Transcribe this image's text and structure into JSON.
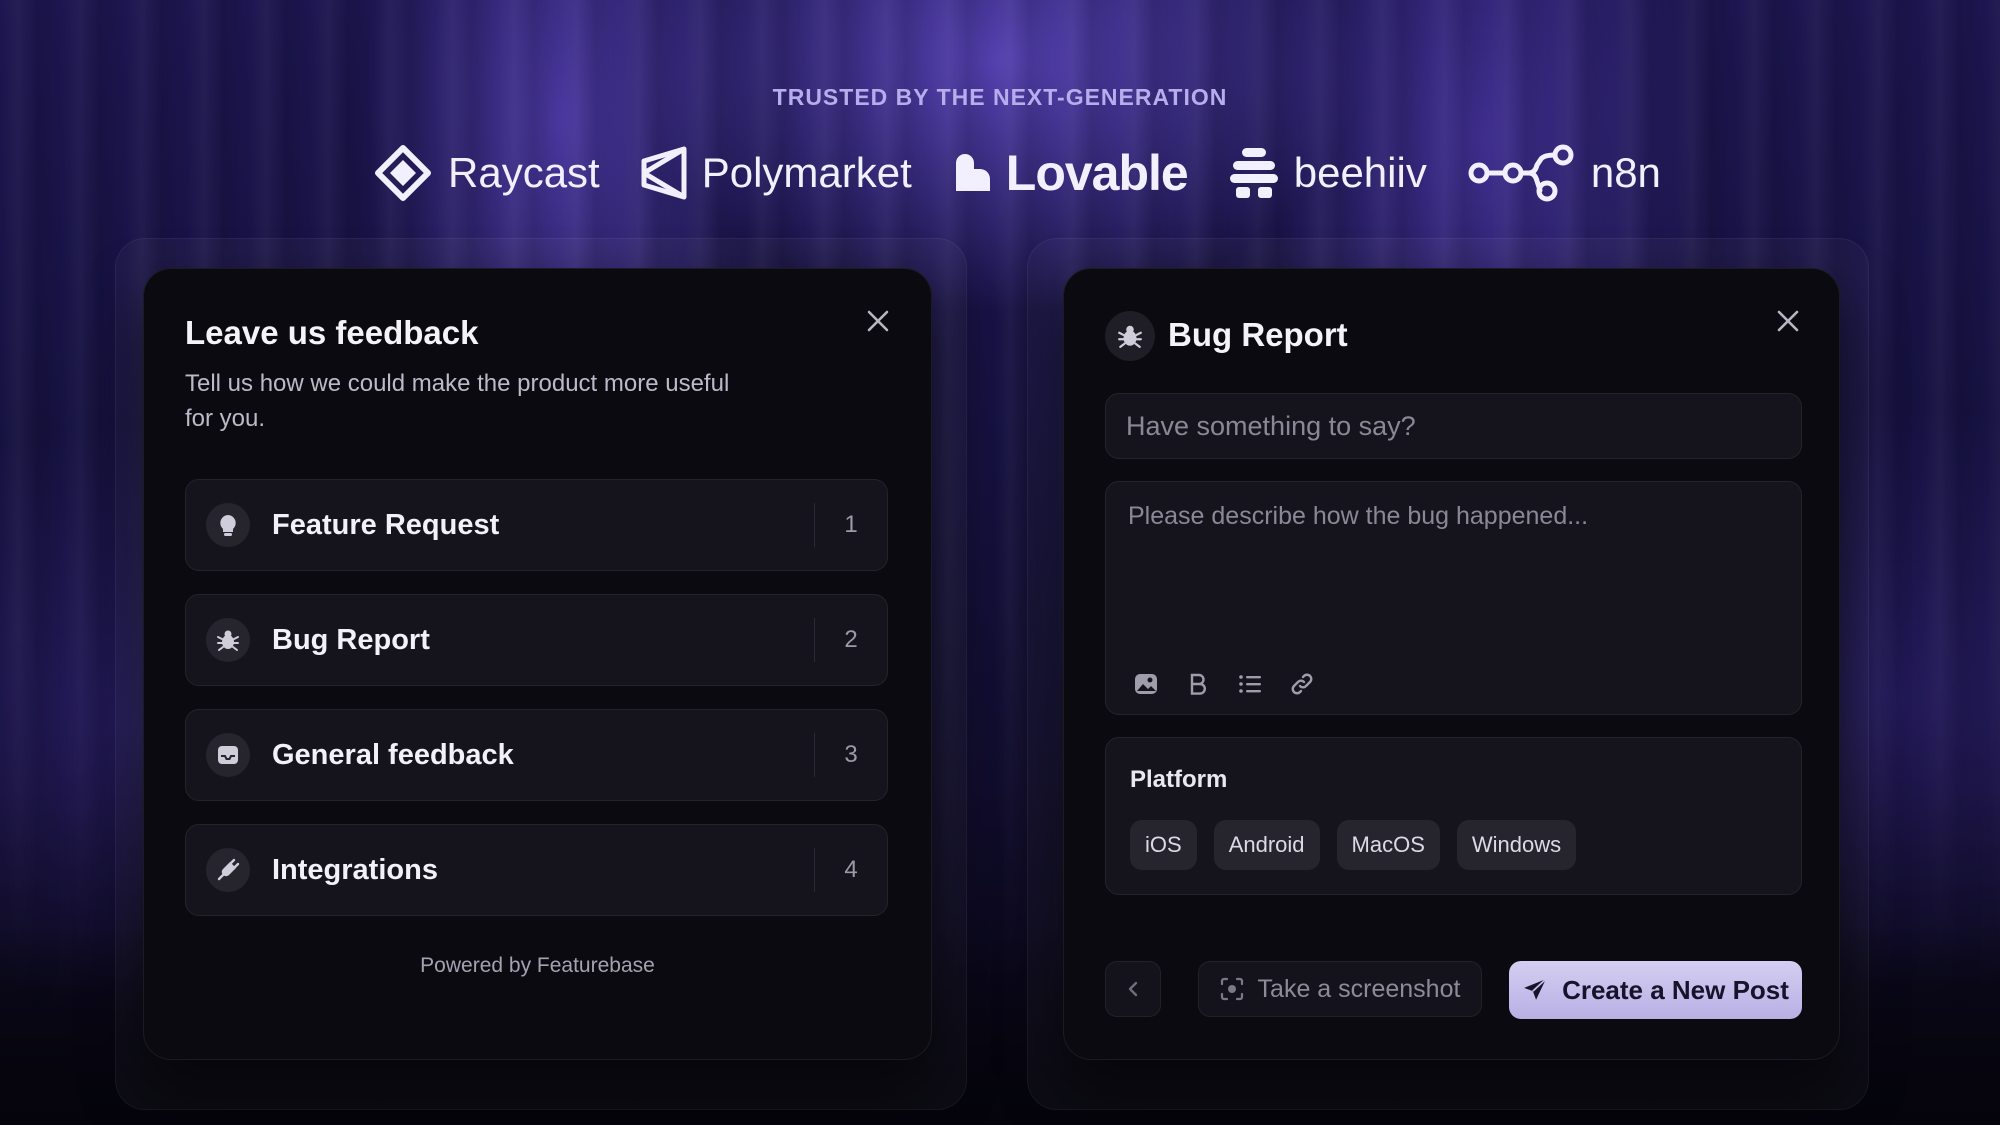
{
  "hero": {
    "trusted_label": "TRUSTED BY THE NEXT-GENERATION",
    "logos": [
      {
        "name": "Raycast",
        "icon": "raycast-logo"
      },
      {
        "name": "Polymarket",
        "icon": "polymarket-logo"
      },
      {
        "name": "Lovable",
        "icon": "lovable-logo"
      },
      {
        "name": "beehiiv",
        "icon": "beehiiv-logo"
      },
      {
        "name": "n8n",
        "icon": "n8n-logo"
      }
    ]
  },
  "feedback_panel": {
    "title": "Leave us feedback",
    "subtitle": "Tell us how we could make the product more useful for you.",
    "close_icon": "close-icon",
    "options": [
      {
        "label": "Feature Request",
        "number": "1",
        "icon": "lightbulb-icon"
      },
      {
        "label": "Bug Report",
        "number": "2",
        "icon": "bug-icon"
      },
      {
        "label": "General feedback",
        "number": "3",
        "icon": "inbox-icon"
      },
      {
        "label": "Integrations",
        "number": "4",
        "icon": "plug-icon"
      }
    ],
    "powered_by": "Powered by Featurebase"
  },
  "bug_panel": {
    "title": "Bug Report",
    "title_icon": "bug-icon",
    "close_icon": "close-icon",
    "title_input": {
      "placeholder": "Have something to say?",
      "value": ""
    },
    "description": {
      "placeholder": "Please describe how the bug happened...",
      "value": ""
    },
    "toolbar": [
      "image-icon",
      "bold-icon",
      "list-icon",
      "link-icon"
    ],
    "platform": {
      "label": "Platform",
      "options": [
        "iOS",
        "Android",
        "MacOS",
        "Windows"
      ]
    },
    "actions": {
      "back_icon": "chevron-left-icon",
      "screenshot_label": "Take a screenshot",
      "submit_label": "Create a New Post"
    }
  },
  "colors": {
    "background": "#0e0b24",
    "accent_glow": "#7a5cff",
    "panel": "#0b0a11",
    "card": "#15141c",
    "primary_button": "#c7c0ee",
    "trusted_text": "#b7acec"
  }
}
